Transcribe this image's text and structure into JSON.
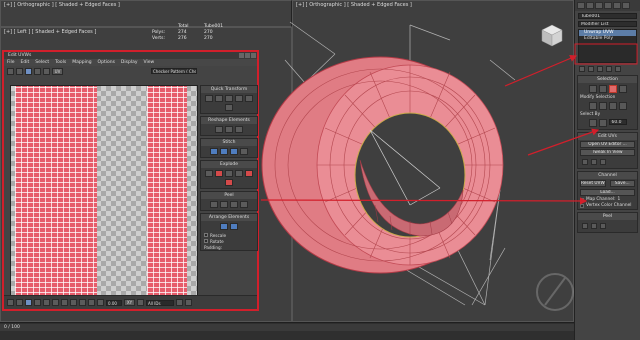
{
  "viewports": {
    "top_label": "[+] [ Orthographic ] [ Shaded + Edged Faces ]",
    "main_label": "[+] [ Orthographic ] [ Shaded + Edged Faces ]",
    "left_label": "[+] [ Left ] [ Shaded + Edged Faces ]"
  },
  "stats": {
    "header": [
      "Total",
      "Tube001"
    ],
    "polys_label": "Polys:",
    "polys_total": "274",
    "polys_obj": "270",
    "verts_label": "Verts:",
    "verts_total": "276",
    "verts_obj": "270"
  },
  "command_panel": {
    "object_name": "Tube001",
    "modifier_list": "Modifier List",
    "stack": [
      {
        "label": "Unwrap UVW",
        "selected": true
      },
      {
        "label": "Editable Poly",
        "selected": false
      }
    ],
    "selection_title": "Selection",
    "modify_selection_title": "Modify Selection",
    "select_by_title": "Select By",
    "edit_uvs_title": "Edit UVs",
    "open_uv_editor": "Open UV Editor ...",
    "tweak_in_view": "Tweak In View",
    "channel_title": "Channel",
    "reset_uvws": "Reset UVWs",
    "save": "Save...",
    "load": "Load...",
    "map_channel": "Map Channel:",
    "vertex_color_channel": "Vertex Color Channel",
    "peel_title": "Peel",
    "value_a": "60.0",
    "value_b": "1"
  },
  "uv_window": {
    "title": "Edit UVWs",
    "menu": [
      "File",
      "Edit",
      "Select",
      "Tools",
      "Mapping",
      "Options",
      "Display",
      "View"
    ],
    "uv_label": "UV",
    "pattern": "Checker Pattern ( Checker )",
    "panels": {
      "quick_transform": "Quick Transform",
      "reshape": "Reshape Elements",
      "stitch": "Stitch",
      "explode": "Explode",
      "peel": "Peel",
      "arrange": "Arrange Elements"
    },
    "rescale": "Rescale",
    "rotate": "Rotate",
    "padding": "Padding:",
    "zoom_value": "0.00",
    "uv_dropdown": "All IDs",
    "xy_label": "XY"
  },
  "timeline": {
    "range": "0 / 100"
  },
  "colors": {
    "highlight_red": "#d21f2b",
    "checker_red": "#e65c6b",
    "selection_blue": "#5c7da7"
  }
}
